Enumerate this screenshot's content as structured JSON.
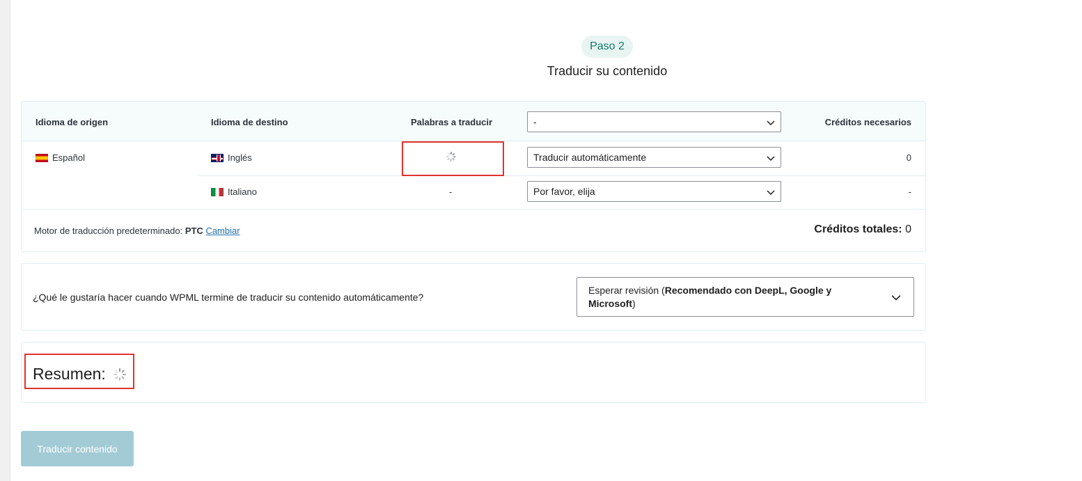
{
  "step": {
    "badge": "Paso 2",
    "title": "Traducir su contenido"
  },
  "table": {
    "headers": {
      "source": "Idioma de origen",
      "target": "Idioma de destino",
      "words": "Palabras a traducir",
      "method_select": "-",
      "credits": "Créditos necesarios"
    },
    "source_language": "Español",
    "rows": [
      {
        "target": "Inglés",
        "words": "",
        "method": "Traducir automáticamente",
        "credits": "0"
      },
      {
        "target": "Italiano",
        "words": "-",
        "method": "Por favor, elija",
        "credits": "-"
      }
    ],
    "footer": {
      "engine_label": "Motor de traducción predeterminado:",
      "engine_name": "PTC",
      "change_link": "Cambiar",
      "total_label": "Créditos totales:",
      "total_value": "0"
    }
  },
  "question": {
    "text": "¿Qué le gustaría hacer cuando WPML termine de traducir su contenido automáticamente?",
    "select_prefix": "Esperar revisión (",
    "select_bold": "Recomendado con DeepL, Google y Microsoft",
    "select_suffix": ")"
  },
  "summary": {
    "title": "Resumen:"
  },
  "actions": {
    "translate_button": "Traducir contenido"
  },
  "icons": {
    "loading": "spinner-icon",
    "dropdown": "chevron-down-icon"
  },
  "colors": {
    "accent": "#117a6b",
    "badge_bg": "#e8f4f2",
    "link": "#2271b1",
    "highlight": "#e2322c",
    "button_disabled": "#a3cbd6"
  }
}
